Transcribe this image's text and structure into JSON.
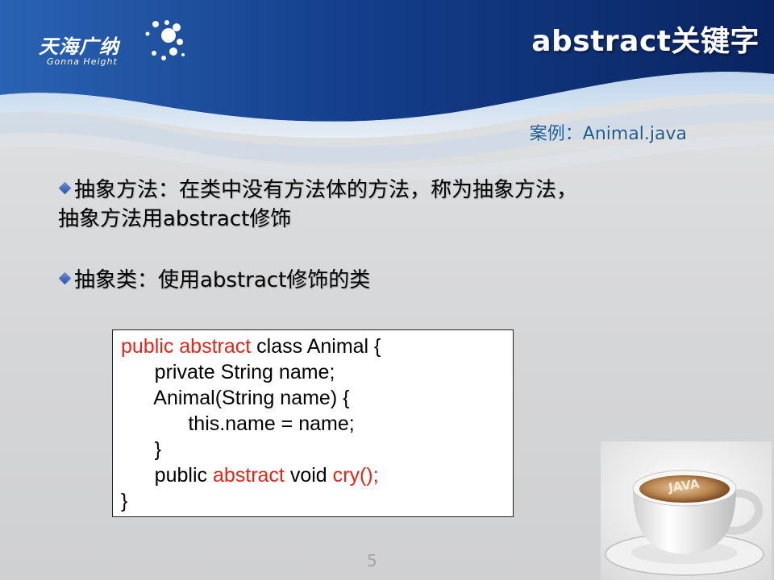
{
  "logo": {
    "name": "天海广纳",
    "subtitle": "Gonna Height"
  },
  "title": "abstract关键字",
  "case_label": "案例：Animal.java",
  "bullets": [
    {
      "line1": "抽象方法：在类中没有方法体的方法，称为抽象方法，",
      "line2": "抽象方法用abstract修饰"
    },
    {
      "line1": "抽象类：使用abstract修饰的类"
    }
  ],
  "code": {
    "line1_kw1": "public",
    "line1_kw2": "abstract",
    "line1_rest": " class Animal {",
    "line2": "      private String name;",
    "line3": "      Animal(String name) {",
    "line4": "            this.name = name;",
    "line5": "      }",
    "line6_pre": "      public ",
    "line6_kw": "abstract",
    "line6_mid": " void ",
    "line6_kw2": "cry();",
    "line7": "}"
  },
  "cup_label": "JAVA",
  "page_number": "5",
  "colors": {
    "header_dark": "#0b2a6e",
    "header_mid": "#1d4f9c",
    "keyword_red": "#e3261b",
    "case_blue": "#1f5a93",
    "bullet_blue": "#2d4fa8"
  }
}
